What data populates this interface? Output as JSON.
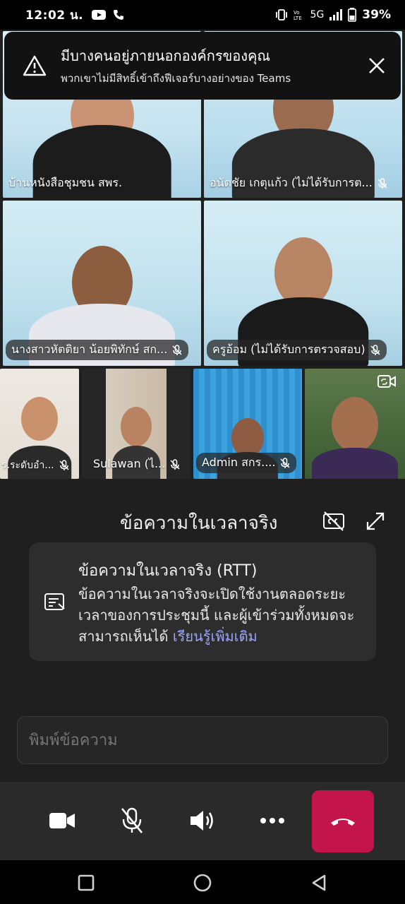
{
  "status_bar": {
    "time": "12:02 น.",
    "network": "5G",
    "battery": "39%"
  },
  "banner": {
    "title": "มีบางคนอยู่ภายนอกองค์กรของคุณ",
    "subtitle": "พวกเขาไม่มีสิทธิ์เข้าถึงฟีเจอร์บางอย่างของ Teams"
  },
  "participants": [
    {
      "name": "บ้านหนังสือชุมชน  สพร."
    },
    {
      "name": "อนัตชัย เกตุแก้ว (ไม่ได้รับการต..."
    },
    {
      "name": "นางสาวหัตติยา น้อยพิทักษ์ สก..."
    },
    {
      "name": "ครูอ้อม (ไม่ได้รับการตรวจสอบ)"
    },
    {
      "name": "ร.ระดับอำ..."
    },
    {
      "name": "Sulawan  (ไ..."
    },
    {
      "name": "Admin สกร...."
    },
    {
      "name": ""
    }
  ],
  "rtt": {
    "header": "ข้อความในเวลาจริง",
    "card_title": "ข้อความในเวลาจริง (RTT)",
    "card_body": "ข้อความในเวลาจริงจะเปิดใช้งานตลอดระยะเวลาของการประชุมนี้ และผู้เข้าร่วมทั้งหมดจะสามารถเห็นได้",
    "card_link": "เรียนรู้เพิ่มเติม",
    "input_placeholder": "พิมพ์ข้อความ"
  },
  "colors": {
    "hangup": "#c4144c",
    "link": "#9aa6ff",
    "background": "#1f1f1f"
  }
}
